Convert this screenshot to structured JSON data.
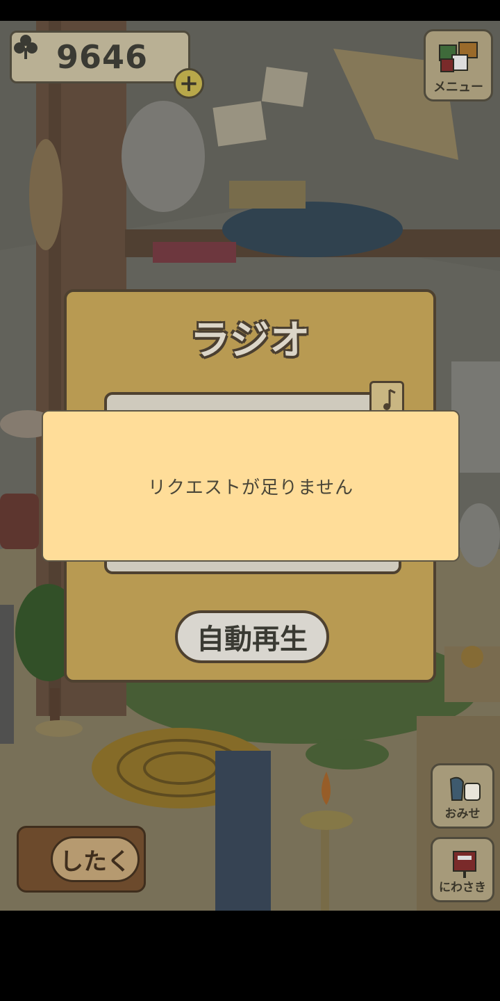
{
  "status_bar": {},
  "hud": {
    "clover_count": "9646",
    "clover_icon": "clover-icon",
    "plus_label": "+",
    "menu_label": "メニュー"
  },
  "side_buttons": {
    "shop_label": "おみせ",
    "garden_label": "にわさき"
  },
  "prepare_button": {
    "label": "したく"
  },
  "radio_dialog": {
    "title": "ラジオ",
    "autoplay_label": "自動再生"
  },
  "toast": {
    "message": "リクエストが足りません"
  },
  "colors": {
    "toast_bg": "#ffdd99",
    "dialog_bg": "#b89a52",
    "accent_plus": "#b8a84a"
  }
}
